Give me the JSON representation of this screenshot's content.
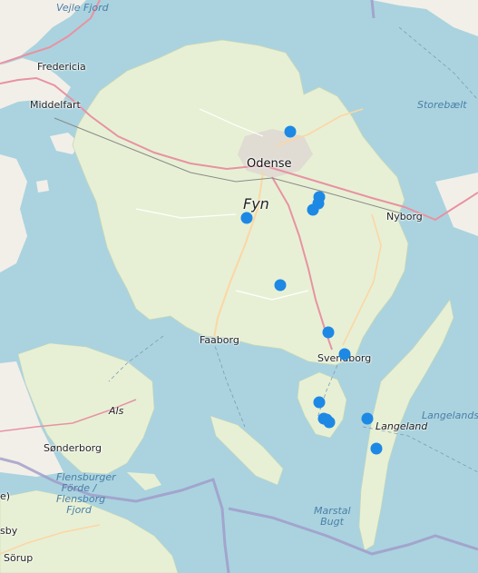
{
  "map": {
    "colors": {
      "water": "#aad3df",
      "land": "#f2efe9",
      "field": "#e7f0d5",
      "motorway": "#e892a2",
      "primary": "#fcd6a4",
      "boundary": "#a09ac8",
      "marker": "#1e88e5"
    },
    "labels": {
      "vejle_fjord": "Vejle Fjord",
      "fredericia": "Fredericia",
      "middelfart": "Middelfart",
      "storebaelt": "Storebælt",
      "odense": "Odense",
      "fyn": "Fyn",
      "nyborg": "Nyborg",
      "faaborg": "Faaborg",
      "svendborg": "Svendborg",
      "als": "Als",
      "langeland": "Langeland",
      "langelandsbaelt": "Langelandsb",
      "sonderborg": "Sønderborg",
      "flensburger_1": "Flensburger",
      "flensburger_2": "Förde /",
      "flensburger_3": "Flensborg",
      "flensburger_4": "Fjord",
      "marstal_1": "Marstal",
      "marstal_2": "Bugt",
      "sorup": "Sörup",
      "edge_e": "e)",
      "edge_sby": "sby"
    },
    "markers": [
      {
        "id": "m1"
      },
      {
        "id": "m2"
      },
      {
        "id": "m3"
      },
      {
        "id": "m4"
      },
      {
        "id": "m5"
      },
      {
        "id": "m6"
      },
      {
        "id": "m7"
      },
      {
        "id": "m8"
      },
      {
        "id": "m9"
      },
      {
        "id": "m10"
      },
      {
        "id": "m11"
      },
      {
        "id": "m12"
      },
      {
        "id": "m13"
      },
      {
        "id": "m14"
      }
    ]
  }
}
